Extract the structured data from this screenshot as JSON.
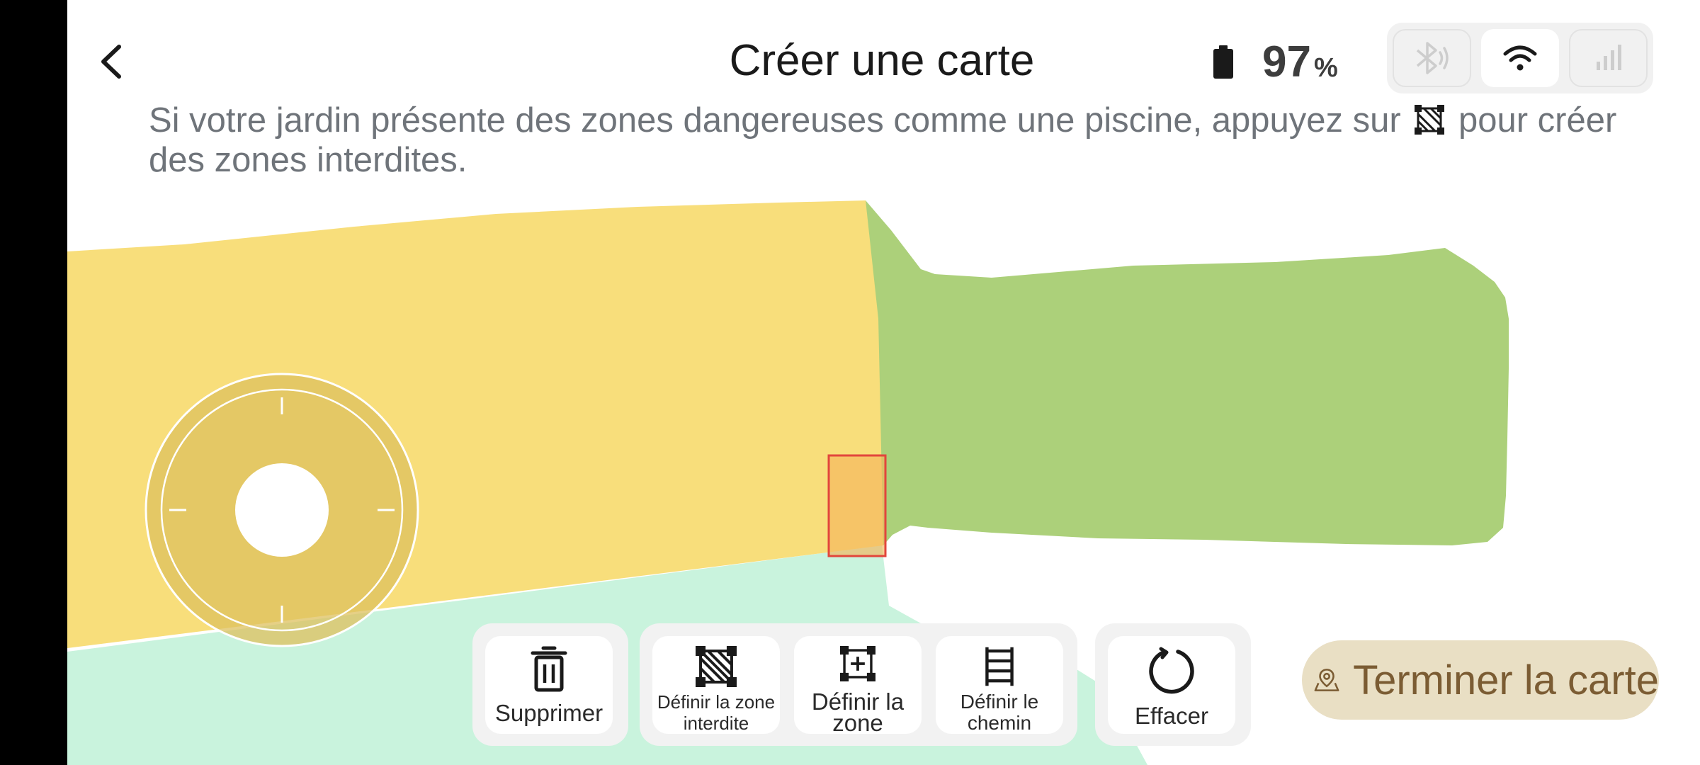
{
  "header": {
    "title": "Créer une carte",
    "battery_percent": "97",
    "battery_unit": "%"
  },
  "connectivity": {
    "bluetooth": "off",
    "wifi": "on",
    "cellular": "off"
  },
  "instruction": {
    "before_icon": "Si votre jardin présente des zones dangereuses comme une piscine, appuyez sur",
    "after_icon": "pour créer des zones interdites."
  },
  "toolbar": {
    "delete_label": "Supprimer",
    "no_go_zone_label": "Définir la zone interdite",
    "define_zone_label": "Définir la zone",
    "define_path_label": "Définir le chemin",
    "clear_label": "Effacer"
  },
  "finish": {
    "label": "Terminer la carte"
  },
  "icons": {
    "back": "back-icon",
    "battery": "battery-icon",
    "bluetooth": "bluetooth-icon",
    "wifi": "wifi-icon",
    "cellular": "cellular-icon",
    "delete": "trash-icon",
    "no_go": "no-go-zone-icon",
    "zone": "add-zone-icon",
    "path": "ladder-path-icon",
    "clear": "refresh-icon",
    "finish": "map-pin-icon"
  },
  "colors": {
    "zone_yellow": "#f8de7b",
    "zone_green": "#acd07a",
    "zone_mint": "#c9f3dd",
    "selection": "#e2463c",
    "finish_bg": "#e9dfc4",
    "finish_text": "#7b5c33"
  }
}
